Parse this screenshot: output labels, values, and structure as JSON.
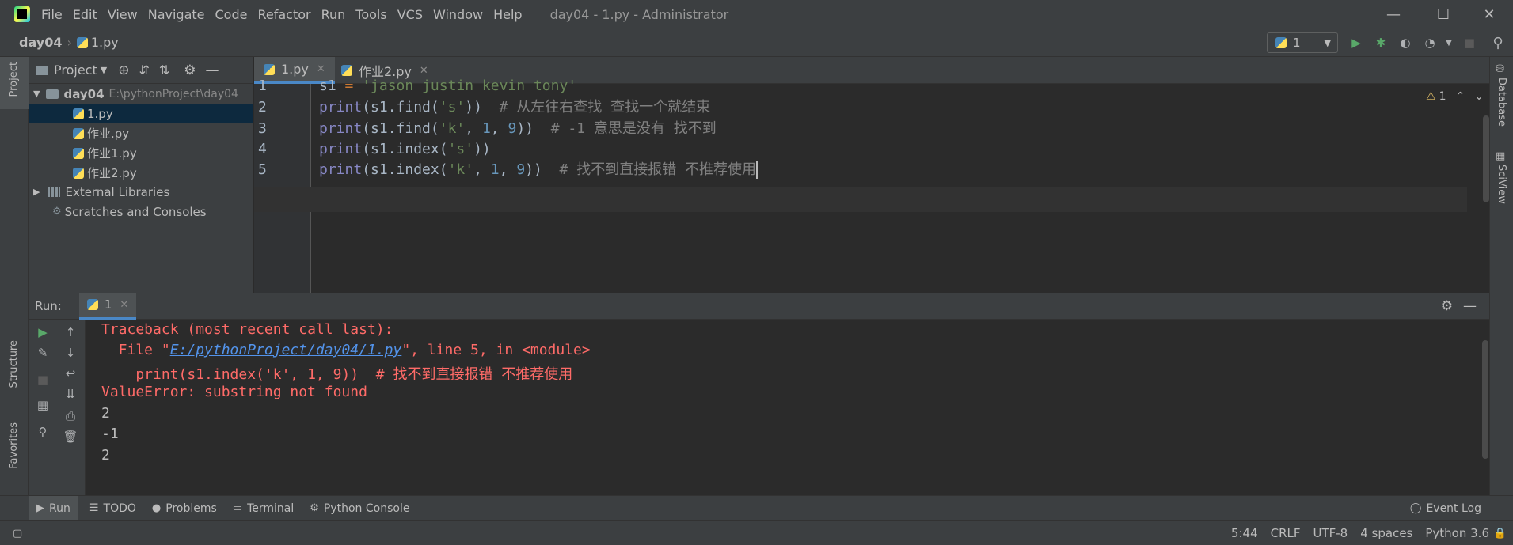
{
  "app": {
    "menu": [
      "File",
      "Edit",
      "View",
      "Navigate",
      "Code",
      "Refactor",
      "Run",
      "Tools",
      "VCS",
      "Window",
      "Help"
    ],
    "window_title": "day04 - 1.py - Administrator"
  },
  "navbar": {
    "project": "day04",
    "file": "1.py",
    "run_config": "1"
  },
  "project_panel": {
    "title": "Project",
    "root_name": "day04",
    "root_path": "E:\\pythonProject\\day04",
    "files": [
      "1.py",
      "作业.py",
      "作业1.py",
      "作业2.py"
    ],
    "external": "External Libraries",
    "scratches": "Scratches and Consoles"
  },
  "editor": {
    "tabs": [
      "1.py",
      "作业2.py"
    ],
    "line_numbers": [
      "1",
      "2",
      "3",
      "4",
      "5"
    ],
    "warning_count": "1",
    "lines": [
      {
        "s1": "s1",
        "eq": " = ",
        "str": "'jason justin kevin tony'"
      },
      {
        "print": "print",
        "a": "(s1.",
        "fn": "find",
        "b": "(",
        "str": "'s'",
        "c": "))",
        "cmt": "  # 从左往右查找 查找一个就结束"
      },
      {
        "print": "print",
        "a": "(s1.",
        "fn": "find",
        "b": "(",
        "str": "'k'",
        "c": ", ",
        "n1": "1",
        "d": ", ",
        "n2": "9",
        "e": "))",
        "cmt": "  # -1 意思是没有 找不到"
      },
      {
        "print": "print",
        "a": "(s1.",
        "fn": "index",
        "b": "(",
        "str": "'s'",
        "c": "))"
      },
      {
        "print": "print",
        "a": "(s1.",
        "fn": "index",
        "b": "(",
        "str": "'k'",
        "c": ", ",
        "n1": "1",
        "d": ", ",
        "n2": "9",
        "e": "))",
        "cmt": "  # 找不到直接报错 不推荐使用"
      }
    ]
  },
  "run_panel": {
    "label": "Run:",
    "tab": "1",
    "output": {
      "l1": "Traceback (most recent call last):",
      "l2_pre": "  File \"",
      "l2_link": "E:/pythonProject/day04/1.py",
      "l2_post": "\", line 5, in <module>",
      "l3": "    print(s1.index('k', 1, 9))  # 找不到直接报错 不推荐使用",
      "l4": "ValueError: substring not found",
      "l5": "2",
      "l6": "-1",
      "l7": "2"
    }
  },
  "left_stripe": {
    "project": "Project",
    "structure": "Structure",
    "favorites": "Favorites"
  },
  "right_stripe": {
    "database": "Database",
    "sciview": "SciView"
  },
  "bottom_tabs": [
    "Run",
    "TODO",
    "Problems",
    "Terminal",
    "Python Console"
  ],
  "event_log": "Event Log",
  "status": {
    "position": "5:44",
    "line_sep": "CRLF",
    "encoding": "UTF-8",
    "indent": "4 spaces",
    "interpreter": "Python 3.6"
  }
}
